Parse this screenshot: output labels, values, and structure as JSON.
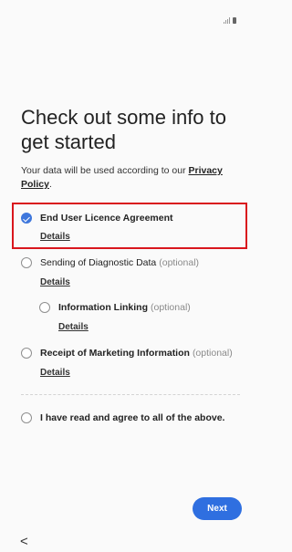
{
  "page": {
    "title": "Check out some info to get started",
    "policy_text": "Your data will be used according to our ",
    "policy_link": "Privacy Policy",
    "policy_end": "."
  },
  "items": [
    {
      "label": "End User Licence Agreement",
      "optional": "",
      "details": "Details",
      "checked": true
    },
    {
      "label": "Sending of Diagnostic Data",
      "optional": "(optional)",
      "details": "Details",
      "checked": false
    },
    {
      "label": "Information Linking",
      "optional": "(optional)",
      "details": "Details",
      "checked": false
    },
    {
      "label": "Receipt of Marketing Information",
      "optional": "(optional)",
      "details": "Details",
      "checked": false
    }
  ],
  "agree_all": {
    "label": "I have read and agree to all of the above.",
    "checked": false
  },
  "buttons": {
    "next": "Next",
    "back": "<"
  },
  "icons": {
    "signal": "signal-icon",
    "battery": "battery-icon",
    "check": "check-icon",
    "back": "back-chevron-icon"
  },
  "colors": {
    "accent": "#2f6fe0",
    "checked": "#3e77dc",
    "highlight_border": "#d9161d",
    "background": "#fafafa"
  }
}
